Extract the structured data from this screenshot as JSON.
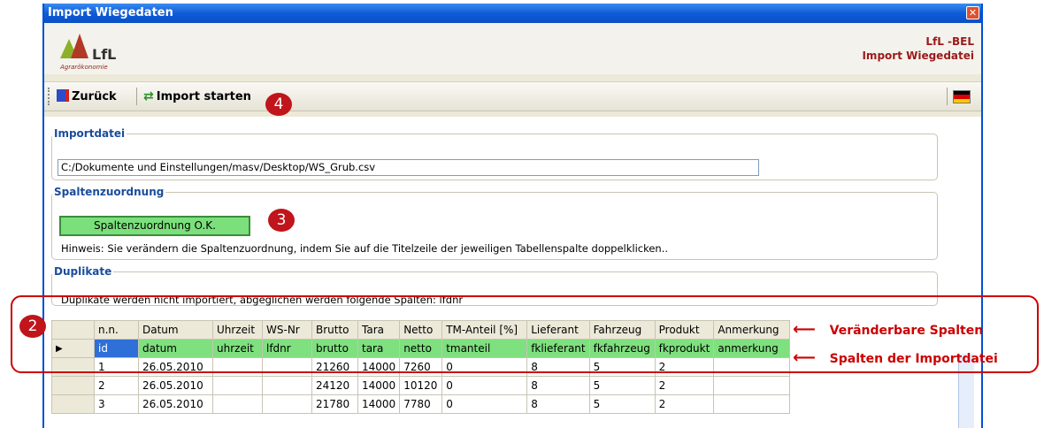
{
  "window": {
    "title": "Import Wiegedaten",
    "close_glyph": "✕"
  },
  "header": {
    "logo_text": "LfL",
    "logo_subtitle": "Agrarökonomie",
    "right_line1": "LfL -BEL",
    "right_line2": "Import Wiegedatei"
  },
  "toolbar": {
    "back_label": "Zurück",
    "import_label": "Import starten",
    "icons": {
      "back": "back-door-icon",
      "import": "import-arrows-icon",
      "language": "german-flag-icon"
    }
  },
  "callouts": {
    "c2": "2",
    "c3": "3",
    "c4": "4"
  },
  "importdatei": {
    "legend": "Importdatei",
    "path": "C:/Dokumente und Einstellungen/masv/Desktop/WS_Grub.csv"
  },
  "spaltenzuordnung": {
    "legend": "Spaltenzuordnung",
    "button_label": "Spaltenzuordnung O.K.",
    "hint": "Hinweis: Sie verändern die Spaltenzuordnung, indem Sie auf die Titelzeile der jeweiligen Tabellenspalte doppelklicken.."
  },
  "duplikate": {
    "legend": "Duplikate",
    "hint": "Duplikate werden nicht importiert, abgeglichen werden folgende Spalten:  lfdnr"
  },
  "grid": {
    "columns": [
      "n.n.",
      "Datum",
      "Uhrzeit",
      "WS-Nr",
      "Brutto",
      "Tara",
      "Netto",
      "TM-Anteil [%]",
      "Lieferant",
      "Fahrzeug",
      "Produkt",
      "Anmerkung"
    ],
    "source_columns": [
      "id",
      "datum",
      "uhrzeit",
      "lfdnr",
      "brutto",
      "tara",
      "netto",
      "tmanteil",
      "fklieferant",
      "fkfahrzeug",
      "fkprodukt",
      "anmerkung"
    ],
    "rows": [
      [
        "1",
        "26.05.2010",
        "",
        "",
        "21260",
        "14000",
        "7260",
        "0",
        "8",
        "5",
        "2",
        ""
      ],
      [
        "2",
        "26.05.2010",
        "",
        "",
        "24120",
        "14000",
        "10120",
        "0",
        "8",
        "5",
        "2",
        ""
      ],
      [
        "3",
        "26.05.2010",
        "",
        "",
        "21780",
        "14000",
        "7780",
        "0",
        "8",
        "5",
        "2",
        ""
      ]
    ],
    "current_row_glyph": "▶"
  },
  "annotations": {
    "changeable_columns": "Veränderbare Spalten",
    "import_columns": "Spalten der Importdatei",
    "arrow_glyph": "⟵"
  },
  "colors": {
    "highlight": "#c00000",
    "mapping_ok": "#7be07b",
    "selected_cell": "#2f6fd8",
    "titlebar": "#0a4fc6"
  }
}
